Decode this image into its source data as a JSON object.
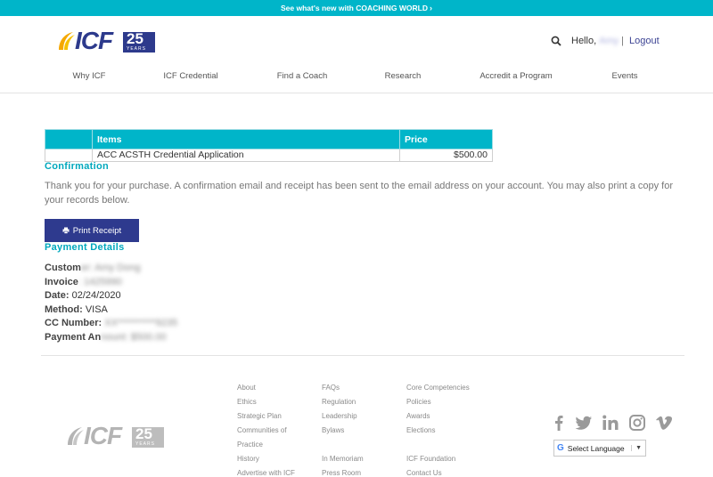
{
  "banner": {
    "text": "See what's new with COACHING WORLD"
  },
  "header": {
    "hello_label": "Hello,",
    "user_name": "Amy",
    "separator": "|",
    "logout_label": "Logout",
    "logo_text": "ICF",
    "logo_number": "25",
    "logo_years": "YEARS"
  },
  "nav": {
    "items": [
      {
        "label": "Why ICF"
      },
      {
        "label": "ICF Credential"
      },
      {
        "label": "Find a Coach"
      },
      {
        "label": "Research"
      },
      {
        "label": "Accredit a Program"
      },
      {
        "label": "Events"
      }
    ]
  },
  "items_table": {
    "headers": [
      "",
      "Items",
      "Price"
    ],
    "rows": [
      {
        "item": "ACC ACSTH Credential Application",
        "price": "$500.00"
      }
    ]
  },
  "confirmation": {
    "title": "Confirmation",
    "message": "Thank you for your purchase. A confirmation email and receipt has been sent to the email address on your account. You may also print a copy for your records below.",
    "print_label": "Print Receipt"
  },
  "payment": {
    "title": "Payment Details",
    "customer_label": "Custom",
    "customer_value": "er: Amy Dong",
    "invoice_label": "Invoice",
    "invoice_value": ": 1425990",
    "date_label": "Date:",
    "date_value": "02/24/2020",
    "method_label": "Method:",
    "method_value": "VISA",
    "cc_label": "CC Number:",
    "cc_value": "XX**********9235",
    "amount_label": "Payment An",
    "amount_value": "nount: $500.00"
  },
  "footer": {
    "col1": [
      "About",
      "Ethics",
      "Strategic Plan",
      "Communities of",
      "Practice",
      "History",
      "Advertise with ICF"
    ],
    "col2": [
      "FAQs",
      "Regulation",
      "Leadership",
      "Bylaws",
      "In Memoriam",
      "Press Room"
    ],
    "col3": [
      "Core Competencies",
      "Policies",
      "Awards",
      "Elections",
      "ICF Foundation",
      "Contact Us"
    ],
    "language_label": "Select Language"
  },
  "colors": {
    "accent": "#00b5c9",
    "brand": "#2e3a8e",
    "social": "#9a9a9a"
  }
}
